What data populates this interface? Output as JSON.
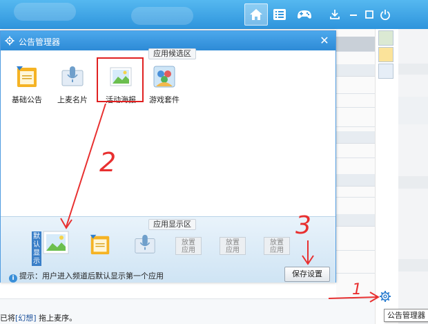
{
  "dialog": {
    "title": "公告管理器",
    "candidate_section_label": "应用候选区",
    "display_section_label": "应用显示区",
    "candidate_apps": [
      {
        "label": "基础公告",
        "icon": "basic-notice-icon"
      },
      {
        "label": "上麦名片",
        "icon": "mic-card-icon"
      },
      {
        "label": "活动海报",
        "icon": "event-poster-icon"
      },
      {
        "label": "游戏套件",
        "icon": "game-kit-icon"
      }
    ],
    "default_badge": "默认显示",
    "placeholder_slots": [
      {
        "line1": "放置",
        "line2": "应用"
      },
      {
        "line1": "放置",
        "line2": "应用"
      },
      {
        "line1": "放置",
        "line2": "应用"
      }
    ],
    "tip": "提示：用户进入频道后默认显示第一个应用",
    "save_button": "保存设置"
  },
  "annotations": {
    "step1": "1",
    "step2": "2",
    "step3": "3"
  },
  "chat_line": {
    "prefix": "已将",
    "user": "[幻想]",
    "suffix": " 拖上麦序。"
  },
  "tooltip": "公告管理器",
  "colors": {
    "accent": "#2e94dc",
    "highlight_box": "#e02020",
    "annotation": "#e83030"
  }
}
